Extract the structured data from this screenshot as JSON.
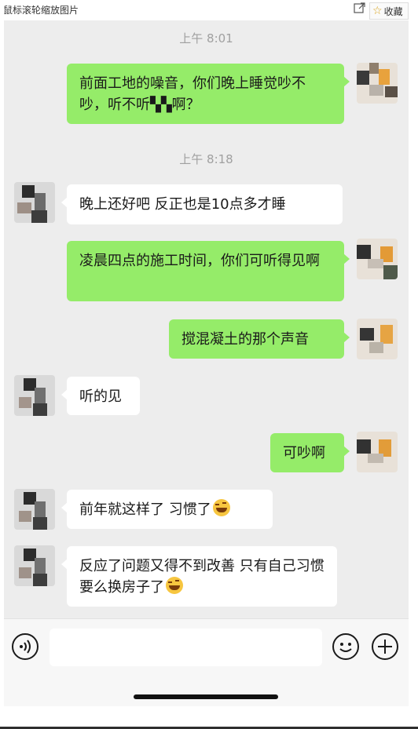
{
  "viewer": {
    "title": "鼠标滚轮缩放图片",
    "favorite_label": "收藏",
    "popout_icon": "external-link-icon",
    "favorite_icon": "star-icon"
  },
  "chat": {
    "timestamps": [
      "上午 8:01",
      "上午 8:18"
    ],
    "messages": [
      {
        "side": "me",
        "text": "前面工地的噪音，你们晚上睡觉吵不吵，听不听▚▚啊？"
      },
      {
        "side": "them",
        "text": "晚上还好吧  反正也是10点多才睡"
      },
      {
        "side": "me",
        "text": "凌晨四点的施工时间，你们可听得见啊"
      },
      {
        "side": "me",
        "text": "搅混凝土的那个声音"
      },
      {
        "side": "them",
        "text": "听的见"
      },
      {
        "side": "me",
        "text": "可吵啊"
      },
      {
        "side": "them",
        "text": "前年就这样了  习惯了",
        "emoji": "grinning-squint-emoji"
      },
      {
        "side": "them",
        "text": "反应了问题又得不到改善  只有自己习惯  要么换房子了",
        "emoji": "tears-of-joy-emoji"
      }
    ]
  },
  "input_bar": {
    "voice_icon": "voice-input-icon",
    "emoji_icon": "emoji-face-icon",
    "plus_icon": "plus-circle-icon",
    "input_value": ""
  },
  "colors": {
    "chat_bg": "#ededed",
    "my_bubble": "#95ec69",
    "their_bubble": "#ffffff",
    "timestamp_text": "#a0a0a0"
  }
}
